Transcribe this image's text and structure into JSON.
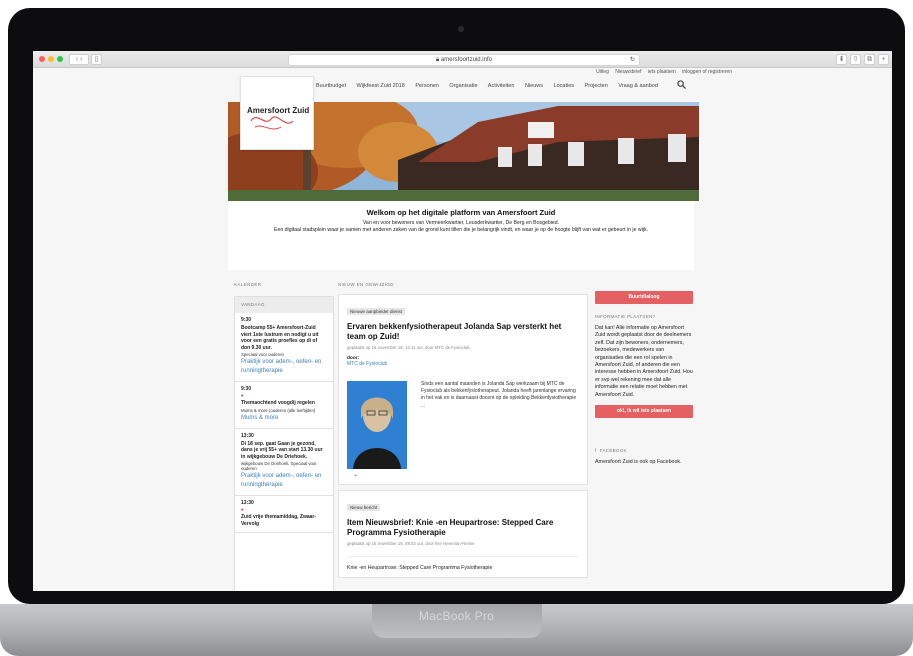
{
  "device": {
    "label": "MacBook Pro"
  },
  "browser": {
    "url": "amersfoortzuid.info",
    "lock_icon": "lock-icon",
    "reload_icon": "reload-icon"
  },
  "site": {
    "top_links": [
      "Uitleg",
      "Nieuwsbrief",
      "iets plaatsen",
      "inloggen of registreren"
    ],
    "logo": "Amersfoort Zuid",
    "nav": [
      "Buurtbudget",
      "Wijkfeest Zuid 2018",
      "Personen",
      "Organisatie",
      "Activiteiten",
      "Nieuws",
      "Locaties",
      "Projecten",
      "Vraag & aanbod"
    ],
    "welcome": {
      "title": "Welkom op het digitale platform van Amersfoort Zuid",
      "line1": "Van en voor bewoners van Vermeerkwartier, Leusderkwartier, De Berg en Bosgebied.",
      "line2": "Een digitaal stadsplein waar je samen met anderen zaken van de grond kunt tillen die je belangrijk vindt, en waar je op de hoogte blijft van wat er gebeurt in je wijk."
    },
    "calendar": {
      "label": "KALENDER",
      "today": "VANDAAG",
      "events": [
        {
          "time": "9:30",
          "title": "Bootcamp 55+ Amersfoort-Zuid viert 1ste lustrum en nodigt u uit voor een gratis proefles op di of don 9.30 uur.",
          "sub": "Speciaal voor ouderen",
          "link": "Praktijk voor adem-, oefen- en runningtherapie",
          "dot": false
        },
        {
          "time": "9:30",
          "title": "Themaochtend voogdij regelen",
          "sub": "Mums & more (ouderen (alle leeftijden)",
          "link": "Mums & more",
          "dot": true
        },
        {
          "time": "13:30",
          "title": "Di 18 sep. gaat Gaan je gezond, dans je vrij 55+ van start 13.30 uur in wijkgebouw De Driehoek.",
          "sub": "wijkgebouw De Driehoek, Speciaal voor ouderen",
          "link": "Praktijk voor adem-, oefen- en runningtherapie",
          "dot": false
        },
        {
          "time": "13:30",
          "title": "Zuid vrije themamiddag, Zwaar-Vervolg",
          "sub": "",
          "link": "",
          "dot": true
        }
      ]
    },
    "news": {
      "label": "NIEUW EN GEWIJZIGD",
      "items": [
        {
          "tag": "Nieuwe aanpbieder dienst",
          "title": "Ervaren bekkenfysiotherapeut Jolanda Sap versterkt het team op Zuid!",
          "meta": "geplaatst op 16 november 18, 12.11 uur, door MTC de Fysioclub",
          "by_label": "door:",
          "by_link": "MTC de Fysioclub",
          "excerpt": "Sinds een aantal maanden is Jolanda Sap werkzaam bij MTC de Fysioclub als bekkenfysiotherapeut. Jolanda heeft jarenlange ervaring in het vak en is daarnaast docent op de opleiding Bekkenfysiotherapie ..."
        },
        {
          "tag": "Nieuw bericht",
          "title": "Item Nieuwsbrief: Knie -en Heupartrose: Stepped Care Programma Fysiotherapie",
          "meta": "geplaatst op 16 november 18, 09.03 uur, door Ilse Heerman-Remie",
          "body": "Knie -en Heupartrose: Stepped Care Programma Fysiotherapie"
        }
      ]
    },
    "sidebar": {
      "button1": "Buurtdialoog",
      "info_heading": "INFORMATIE PLAATSEN?",
      "info_text": "Dat kan! Alle informatie op Amersfoort Zuid wordt geplaatst door de deelnemers zelf. Dat zijn bewoners, ondernemers, bezoekers, medewerkers van organisaties die een rol spelen in Amersfoort Zuid, of anderen die een interesse hebben in Amersfoort Zuid. Hou er svp wel rekening mee dat alle informatie een relatie moet hebben met Amersfoort Zuid.",
      "button2": "ok!, ik wil iets plaatsen",
      "fb_heading": "FACEBOOK",
      "fb_text": "Amersfoort Zuid is ook op Facebook."
    }
  }
}
